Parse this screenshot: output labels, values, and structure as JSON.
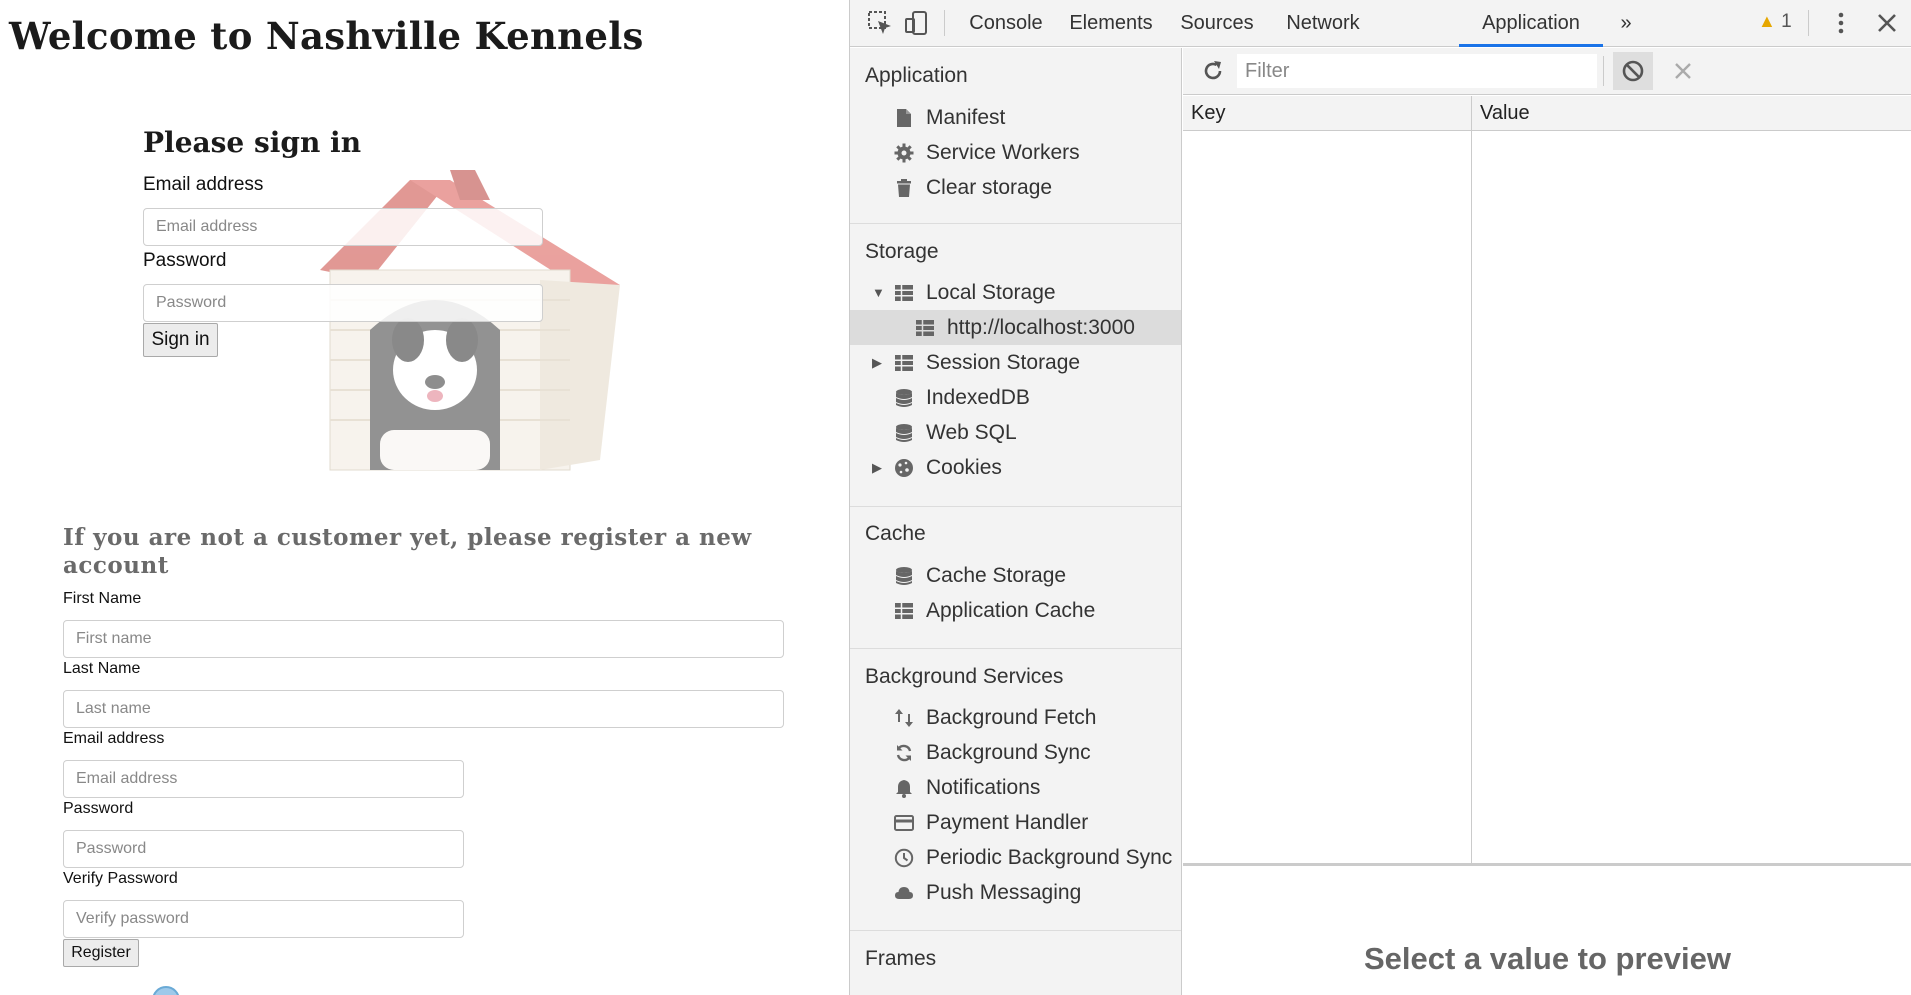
{
  "page": {
    "title": "Welcome to Nashville Kennels",
    "signin": {
      "heading": "Please sign in",
      "email_label": "Email address",
      "email_placeholder": "Email address",
      "password_label": "Password",
      "password_placeholder": "Password",
      "button": "Sign in"
    },
    "register": {
      "heading": "If you are not a customer yet, please register a new account",
      "first_name_label": "First Name",
      "first_name_placeholder": "First name",
      "last_name_label": "Last Name",
      "last_name_placeholder": "Last name",
      "email_label": "Email address",
      "email_placeholder": "Email address",
      "password_label": "Password",
      "password_placeholder": "Password",
      "verify_label": "Verify Password",
      "verify_placeholder": "Verify password",
      "button": "Register"
    }
  },
  "devtools": {
    "tabs": [
      {
        "label": "Console"
      },
      {
        "label": "Elements"
      },
      {
        "label": "Sources"
      },
      {
        "label": "Network"
      },
      {
        "label": "Application",
        "active": true
      }
    ],
    "more_tabs": "»",
    "warnings_count": "1",
    "sidebar": {
      "application": {
        "heading": "Application",
        "items": [
          {
            "label": "Manifest",
            "icon": "document-icon"
          },
          {
            "label": "Service Workers",
            "icon": "gear-icon"
          },
          {
            "label": "Clear storage",
            "icon": "trash-icon"
          }
        ]
      },
      "storage": {
        "heading": "Storage",
        "items": [
          {
            "label": "Local Storage",
            "icon": "grid-icon",
            "expanded": true
          },
          {
            "label": "http://localhost:3000",
            "icon": "grid-icon",
            "selected": true
          },
          {
            "label": "Session Storage",
            "icon": "grid-icon",
            "expanded": false
          },
          {
            "label": "IndexedDB",
            "icon": "database-icon"
          },
          {
            "label": "Web SQL",
            "icon": "database-icon"
          },
          {
            "label": "Cookies",
            "icon": "cookie-icon",
            "expanded": false
          }
        ]
      },
      "cache": {
        "heading": "Cache",
        "items": [
          {
            "label": "Cache Storage",
            "icon": "database-icon"
          },
          {
            "label": "Application Cache",
            "icon": "grid-icon"
          }
        ]
      },
      "background_services": {
        "heading": "Background Services",
        "items": [
          {
            "label": "Background Fetch",
            "icon": "up-down-arrows-icon"
          },
          {
            "label": "Background Sync",
            "icon": "sync-icon"
          },
          {
            "label": "Notifications",
            "icon": "bell-icon"
          },
          {
            "label": "Payment Handler",
            "icon": "card-icon"
          },
          {
            "label": "Periodic Background Sync",
            "icon": "clock-icon"
          },
          {
            "label": "Push Messaging",
            "icon": "cloud-icon"
          }
        ]
      },
      "frames": {
        "heading": "Frames"
      }
    },
    "main": {
      "filter_placeholder": "Filter",
      "columns": {
        "key": "Key",
        "value": "Value"
      },
      "preview_text": "Select a value to preview"
    }
  }
}
